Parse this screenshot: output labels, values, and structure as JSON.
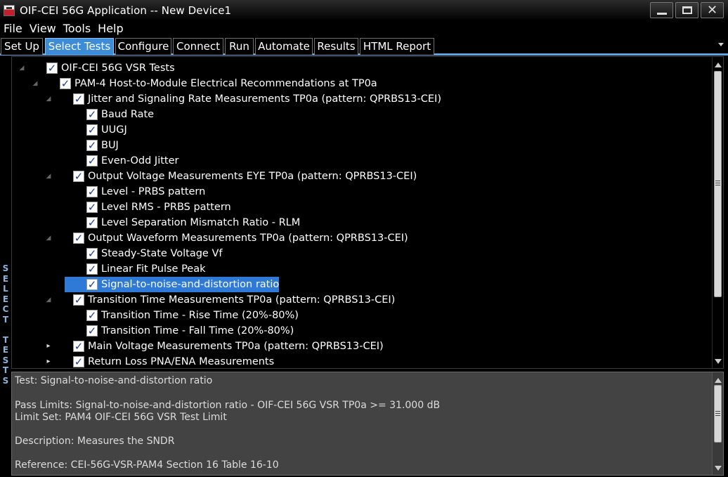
{
  "window": {
    "title": "OIF-CEI 56G Application -- New Device1"
  },
  "menu": [
    "File",
    "View",
    "Tools",
    "Help"
  ],
  "tabs": [
    "Set Up",
    "Select Tests",
    "Configure",
    "Connect",
    "Run",
    "Automate",
    "Results",
    "HTML Report"
  ],
  "active_tab": "Select Tests",
  "side_label": "SELECT TESTS",
  "tree": [
    {
      "label": "OIF-CEI 56G VSR Tests",
      "level": 0,
      "expander": "expanded",
      "checked": true
    },
    {
      "label": "PAM-4 Host-to-Module Electrical Recommendations at TP0a",
      "level": 1,
      "expander": "expanded",
      "checked": true
    },
    {
      "label": "Jitter and Signaling Rate Measurements TP0a (pattern: QPRBS13-CEI)",
      "level": 2,
      "expander": "expanded",
      "checked": true
    },
    {
      "label": "Baud Rate",
      "level": 3,
      "expander": "none",
      "checked": true
    },
    {
      "label": "UUGJ",
      "level": 3,
      "expander": "none",
      "checked": true
    },
    {
      "label": "BUJ",
      "level": 3,
      "expander": "none",
      "checked": true
    },
    {
      "label": "Even-Odd Jitter",
      "level": 3,
      "expander": "none",
      "checked": true
    },
    {
      "label": "Output Voltage Measurements EYE TP0a (pattern: QPRBS13-CEI)",
      "level": 2,
      "expander": "expanded",
      "checked": true
    },
    {
      "label": "Level - PRBS pattern",
      "level": 3,
      "expander": "none",
      "checked": true
    },
    {
      "label": "Level RMS - PRBS pattern",
      "level": 3,
      "expander": "none",
      "checked": true
    },
    {
      "label": "Level Separation Mismatch Ratio - RLM",
      "level": 3,
      "expander": "none",
      "checked": true
    },
    {
      "label": "Output Waveform Measurements TP0a (pattern: QPRBS13-CEI)",
      "level": 2,
      "expander": "expanded",
      "checked": true
    },
    {
      "label": "Steady-State Voltage Vf",
      "level": 3,
      "expander": "none",
      "checked": true
    },
    {
      "label": "Linear Fit Pulse Peak",
      "level": 3,
      "expander": "none",
      "checked": true
    },
    {
      "label": "Signal-to-noise-and-distortion ratio",
      "level": 3,
      "expander": "none",
      "checked": true,
      "selected": true
    },
    {
      "label": "Transition Time Measurements TP0a (pattern: QPRBS13-CEI)",
      "level": 2,
      "expander": "expanded",
      "checked": true
    },
    {
      "label": "Transition Time -  Rise Time (20%-80%)",
      "level": 3,
      "expander": "none",
      "checked": true
    },
    {
      "label": "Transition Time - Fall Time (20%-80%)",
      "level": 3,
      "expander": "none",
      "checked": true
    },
    {
      "label": "Main Voltage Measurements TP0a (pattern: QPRBS13-CEI)",
      "level": 2,
      "expander": "collapsed",
      "checked": true
    },
    {
      "label": "Return Loss PNA/ENA Measurements",
      "level": 2,
      "expander": "collapsed",
      "checked": true
    }
  ],
  "info": {
    "test": "Test: Signal-to-noise-and-distortion ratio",
    "pass_limits": "Pass Limits: Signal-to-noise-and-distortion ratio - OIF-CEI 56G VSR TP0a >= 31.000 dB",
    "limit_set": "Limit Set: PAM4 OIF-CEI 56G VSR Test Limit",
    "description": "Description: Measures the SNDR",
    "reference": "Reference: CEI-56G-VSR-PAM4 Section 16 Table 16-10"
  },
  "colors": {
    "active_tab": "#3c8cd8",
    "selection": "#2e7ad6",
    "tab_underline": "#5aa3e0",
    "info_bg": "#434343"
  }
}
